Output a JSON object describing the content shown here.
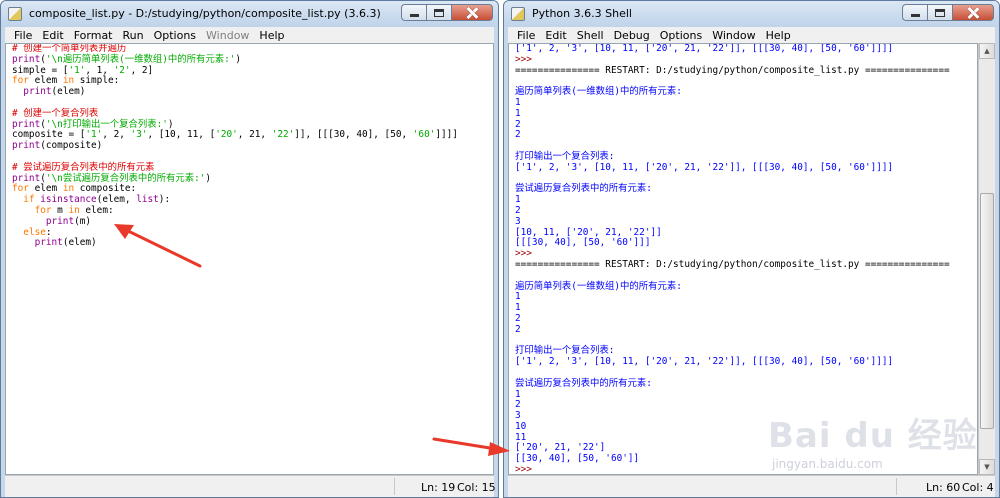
{
  "editor": {
    "title": "composite_list.py - D:/studying/python/composite_list.py (3.6.3)",
    "menu": [
      "File",
      "Edit",
      "Format",
      "Run",
      "Options",
      "Window",
      "Help"
    ],
    "code": [
      [
        [
          "# 创建一个简单列表并遍历",
          "cm"
        ]
      ],
      [
        [
          "print",
          "bi"
        ],
        [
          "(",
          ""
        ],
        [
          "'\\n遍历简单列表(一维数组)中的所有元素:'",
          "str"
        ],
        [
          ")",
          ""
        ]
      ],
      [
        [
          "simple = [",
          ""
        ],
        [
          "'1'",
          "str"
        ],
        [
          ", 1, ",
          ""
        ],
        [
          "'2'",
          "str"
        ],
        [
          ", 2]",
          ""
        ]
      ],
      [
        [
          "for",
          "kw"
        ],
        [
          " elem ",
          ""
        ],
        [
          "in",
          "kw"
        ],
        [
          " simple:",
          ""
        ]
      ],
      [
        [
          "  ",
          ""
        ],
        [
          "print",
          "bi"
        ],
        [
          "(elem)",
          ""
        ]
      ],
      [],
      [
        [
          "# 创建一个复合列表",
          "cm"
        ]
      ],
      [
        [
          "print",
          "bi"
        ],
        [
          "(",
          ""
        ],
        [
          "'\\n打印输出一个复合列表:'",
          "str"
        ],
        [
          ")",
          ""
        ]
      ],
      [
        [
          "composite = [",
          ""
        ],
        [
          "'1'",
          "str"
        ],
        [
          ", 2, ",
          ""
        ],
        [
          "'3'",
          "str"
        ],
        [
          ", [10, 11, [",
          ""
        ],
        [
          "'20'",
          "str"
        ],
        [
          ", 21, ",
          ""
        ],
        [
          "'22'",
          "str"
        ],
        [
          "]], [[[30, 40], [50, ",
          ""
        ],
        [
          "'60'",
          "str"
        ],
        [
          "]]]]",
          ""
        ]
      ],
      [
        [
          "print",
          "bi"
        ],
        [
          "(composite)",
          ""
        ]
      ],
      [],
      [
        [
          "# 尝试遍历复合列表中的所有元素",
          "cm"
        ]
      ],
      [
        [
          "print",
          "bi"
        ],
        [
          "(",
          ""
        ],
        [
          "'\\n尝试遍历复合列表中的所有元素:'",
          "str"
        ],
        [
          ")",
          ""
        ]
      ],
      [
        [
          "for",
          "kw"
        ],
        [
          " elem ",
          ""
        ],
        [
          "in",
          "kw"
        ],
        [
          " composite:",
          ""
        ]
      ],
      [
        [
          "  ",
          ""
        ],
        [
          "if",
          "kw"
        ],
        [
          " ",
          ""
        ],
        [
          "isinstance",
          "bi"
        ],
        [
          "(elem, ",
          ""
        ],
        [
          "list",
          "bi"
        ],
        [
          "):",
          ""
        ]
      ],
      [
        [
          "    ",
          ""
        ],
        [
          "for",
          "kw"
        ],
        [
          " m ",
          ""
        ],
        [
          "in",
          "kw"
        ],
        [
          " elem:",
          ""
        ]
      ],
      [
        [
          "      ",
          ""
        ],
        [
          "print",
          "bi"
        ],
        [
          "(m)",
          ""
        ]
      ],
      [
        [
          "  ",
          ""
        ],
        [
          "else",
          "kw"
        ],
        [
          ":",
          ""
        ]
      ],
      [
        [
          "    ",
          ""
        ],
        [
          "print",
          "bi"
        ],
        [
          "(elem)",
          ""
        ]
      ]
    ],
    "status_ln": "Ln: 19",
    "status_col": "Col: 15"
  },
  "shell": {
    "title": "Python 3.6.3 Shell",
    "menu": [
      "File",
      "Edit",
      "Shell",
      "Debug",
      "Options",
      "Window",
      "Help"
    ],
    "lines": [
      [
        [
          "['1', 2, '3', [10, 11, ['20', 21, '22']], [[[30, 40], [50, '60']]]]",
          "out"
        ]
      ],
      [
        [
          ">>> ",
          "prompt"
        ]
      ],
      [
        [
          "=============== RESTART: D:/studying/python/composite_list.py ===============",
          ""
        ]
      ],
      [],
      [
        [
          "遍历简单列表(一维数组)中的所有元素:",
          "out"
        ]
      ],
      [
        [
          "1",
          "out"
        ]
      ],
      [
        [
          "1",
          "out"
        ]
      ],
      [
        [
          "2",
          "out"
        ]
      ],
      [
        [
          "2",
          "out"
        ]
      ],
      [],
      [
        [
          "打印输出一个复合列表:",
          "out"
        ]
      ],
      [
        [
          "['1', 2, '3', [10, 11, ['20', 21, '22']], [[[30, 40], [50, '60']]]]",
          "out"
        ]
      ],
      [],
      [
        [
          "尝试遍历复合列表中的所有元素:",
          "out"
        ]
      ],
      [
        [
          "1",
          "out"
        ]
      ],
      [
        [
          "2",
          "out"
        ]
      ],
      [
        [
          "3",
          "out"
        ]
      ],
      [
        [
          "[10, 11, ['20', 21, '22']]",
          "out"
        ]
      ],
      [
        [
          "[[[30, 40], [50, '60']]]",
          "out"
        ]
      ],
      [
        [
          ">>> ",
          "prompt"
        ]
      ],
      [
        [
          "=============== RESTART: D:/studying/python/composite_list.py ===============",
          ""
        ]
      ],
      [],
      [
        [
          "遍历简单列表(一维数组)中的所有元素:",
          "out"
        ]
      ],
      [
        [
          "1",
          "out"
        ]
      ],
      [
        [
          "1",
          "out"
        ]
      ],
      [
        [
          "2",
          "out"
        ]
      ],
      [
        [
          "2",
          "out"
        ]
      ],
      [],
      [
        [
          "打印输出一个复合列表:",
          "out"
        ]
      ],
      [
        [
          "['1', 2, '3', [10, 11, ['20', 21, '22']], [[[30, 40], [50, '60']]]]",
          "out"
        ]
      ],
      [],
      [
        [
          "尝试遍历复合列表中的所有元素:",
          "out"
        ]
      ],
      [
        [
          "1",
          "out"
        ]
      ],
      [
        [
          "2",
          "out"
        ]
      ],
      [
        [
          "3",
          "out"
        ]
      ],
      [
        [
          "10",
          "out"
        ]
      ],
      [
        [
          "11",
          "out"
        ]
      ],
      [
        [
          "['20', 21, '22']",
          "out"
        ]
      ],
      [
        [
          "[[30, 40], [50, '60']]",
          "out"
        ]
      ],
      [
        [
          ">>> ",
          "prompt"
        ]
      ]
    ],
    "status_ln": "Ln: 60",
    "status_col": "Col: 4"
  },
  "watermark": {
    "main": "Bai du 经验",
    "sub": "jingyan.baidu.com"
  },
  "icons": {
    "window": "python-file-icon",
    "minimize": "minimize-icon",
    "maximize": "maximize-icon",
    "close": "close-icon",
    "annotation": "red-arrow-icon"
  },
  "colors": {
    "keyword": "#ff7700",
    "builtin": "#900090",
    "string": "#00aa00",
    "comment": "#dd0000",
    "output": "#0000ff",
    "prompt": "#990000",
    "annotation_arrow": "#e8392b"
  }
}
